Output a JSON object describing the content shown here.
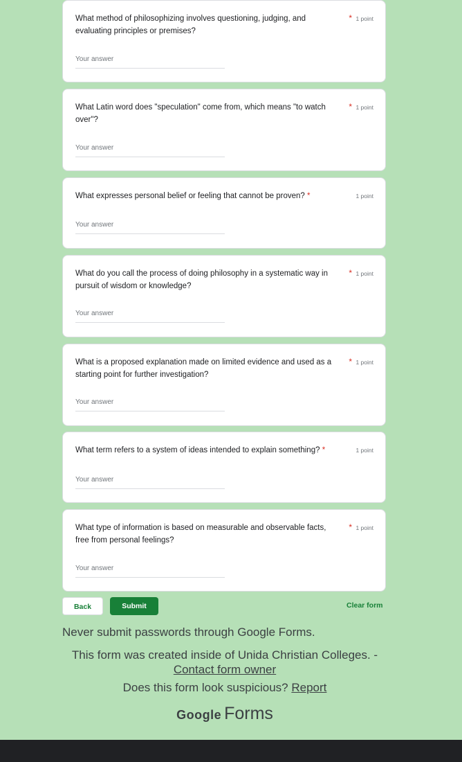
{
  "questions": [
    {
      "text": "What method of philosophizing involves questioning, judging, and evaluating principles or premises?",
      "points": "1 point",
      "placeholder": "Your answer"
    },
    {
      "text": "What Latin word does \"speculation\" come from, which means \"to watch over\"?",
      "points": "1 point",
      "placeholder": "Your answer"
    },
    {
      "text": "What expresses personal belief or feeling that cannot be proven?",
      "points": "1 point",
      "placeholder": "Your answer"
    },
    {
      "text": "What do you call the process of doing philosophy in a systematic way in pursuit of wisdom or knowledge?",
      "points": "1 point",
      "placeholder": "Your answer"
    },
    {
      "text": "What is a proposed explanation made on limited evidence and used as a starting point for further investigation?",
      "points": "1 point",
      "placeholder": "Your answer"
    },
    {
      "text": "What term refers to a system of ideas intended to explain something?",
      "points": "1 point",
      "placeholder": "Your answer"
    },
    {
      "text": "What type of information is based on measurable and observable facts, free from personal feelings?",
      "points": "1 point",
      "placeholder": "Your answer"
    }
  ],
  "required_marker": "*",
  "buttons": {
    "back": "Back",
    "submit": "Submit",
    "clear": "Clear form"
  },
  "footer": {
    "password_warning": "Never submit passwords through Google Forms.",
    "created_text": "This form was created inside of Unida Christian Colleges. -",
    "contact_link": "Contact form owner",
    "suspicious_text": "Does this form look suspicious?",
    "report_link": "Report",
    "brand_google": "Google",
    "brand_forms": "Forms"
  },
  "colors": {
    "background": "#b6e0b7",
    "accent": "#188038",
    "required": "#d93025"
  }
}
